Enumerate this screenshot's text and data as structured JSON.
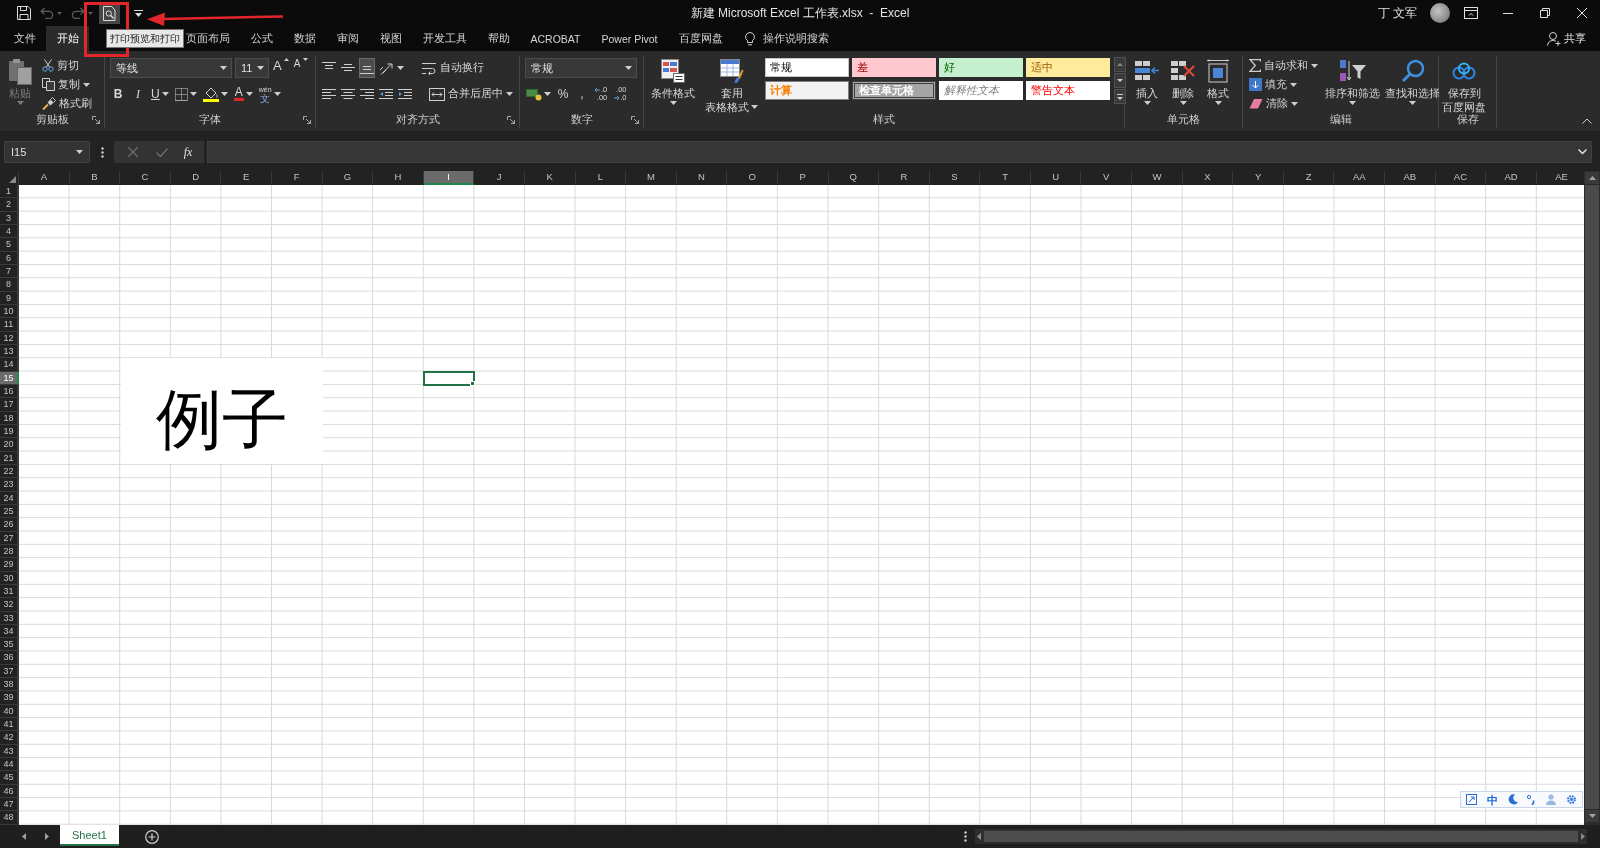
{
  "title_bar": {
    "quick_access": [
      {
        "kind": "save",
        "disabled": false,
        "highlighted": false
      },
      {
        "kind": "undo",
        "disabled": true,
        "highlighted": false
      },
      {
        "kind": "redo",
        "disabled": true,
        "highlighted": false
      },
      {
        "kind": "print_preview",
        "disabled": false,
        "highlighted": true
      },
      {
        "kind": "customize",
        "disabled": false,
        "highlighted": false
      }
    ],
    "title": "新建 Microsoft Excel 工作表.xlsx  -  Excel",
    "user": "丁 文军"
  },
  "tabs": [
    {
      "label": "文件",
      "selected": false
    },
    {
      "label": "开始",
      "selected": true
    },
    {
      "label": "页面布局",
      "selected": false
    },
    {
      "label": "公式",
      "selected": false
    },
    {
      "label": "数据",
      "selected": false
    },
    {
      "label": "审阅",
      "selected": false
    },
    {
      "label": "视图",
      "selected": false
    },
    {
      "label": "开发工具",
      "selected": false
    },
    {
      "label": "帮助",
      "selected": false
    },
    {
      "label": "ACROBAT",
      "selected": false
    },
    {
      "label": "Power Pivot",
      "selected": false
    },
    {
      "label": "百度网盘",
      "selected": false
    }
  ],
  "tell_me": "操作说明搜索",
  "share": "共享",
  "tooltip": "打印预览和打印",
  "ribbon": {
    "clipboard": {
      "label": "剪贴板",
      "paste": {
        "label": "粘贴",
        "disabled": true
      },
      "cut": "剪切",
      "copy": "复制",
      "format_painter": "格式刷"
    },
    "font": {
      "label": "字体",
      "font_name": "等线",
      "font_size": "11",
      "grow": "A",
      "shrink": "A",
      "bold": "B",
      "italic": "I",
      "underline": "U",
      "font_color": "A",
      "phonetic": {
        "ruby": "wén",
        "base": "文"
      }
    },
    "alignment": {
      "label": "对齐方式",
      "vertical": [
        {
          "kind": "top",
          "selected": false
        },
        {
          "kind": "middle",
          "selected": false
        },
        {
          "kind": "bottom",
          "selected": true
        }
      ],
      "wrap_text": "自动换行",
      "merge_center": "合并后居中"
    },
    "number": {
      "label": "数字",
      "format": "常规",
      "percent": "%",
      "comma": ",",
      "decimals": [
        {
          "kind": "increase",
          "top": ".0",
          "bottom": ".00"
        },
        {
          "kind": "decrease",
          "top": ".00",
          "bottom": ".0"
        }
      ]
    },
    "styles": {
      "label": "样式",
      "conditional_formatting": "条件格式",
      "format_as_table": [
        "套用",
        "表格格式"
      ],
      "gallery": [
        {
          "label": "常规",
          "kind": "normal"
        },
        {
          "label": "差",
          "kind": "bad"
        },
        {
          "label": "好",
          "kind": "good"
        },
        {
          "label": "适中",
          "kind": "neutral"
        },
        {
          "label": "计算",
          "kind": "calculation"
        },
        {
          "label": "检查单元格",
          "kind": "check"
        },
        {
          "label": "解释性文本",
          "kind": "explanatory"
        },
        {
          "label": "警告文本",
          "kind": "warning"
        }
      ]
    },
    "cells": {
      "label": "单元格",
      "buttons": [
        {
          "kind": "insert",
          "label": "插入"
        },
        {
          "kind": "delete",
          "label": "删除"
        },
        {
          "kind": "format",
          "label": "格式"
        }
      ]
    },
    "editing": {
      "label": "编辑",
      "autosum": "自动求和",
      "fill": "填充",
      "clear": "清除",
      "sort_filter": "排序和筛选",
      "find_select": "查找和选择"
    },
    "save": {
      "label": "保存",
      "button": [
        "保存到",
        "百度网盘"
      ]
    }
  },
  "formula_bar": {
    "name_box": "I15",
    "buttons": [
      {
        "kind": "cancel",
        "disabled": true
      },
      {
        "kind": "enter",
        "disabled": true
      }
    ],
    "function_symbol": "fx"
  },
  "sheet": {
    "columns": [
      {
        "label": "A",
        "selected": false
      },
      {
        "label": "B",
        "selected": false
      },
      {
        "label": "C",
        "selected": false
      },
      {
        "label": "D",
        "selected": false
      },
      {
        "label": "E",
        "selected": false
      },
      {
        "label": "F",
        "selected": false
      },
      {
        "label": "G",
        "selected": false
      },
      {
        "label": "H",
        "selected": false
      },
      {
        "label": "I",
        "selected": true
      },
      {
        "label": "J",
        "selected": false
      },
      {
        "label": "K",
        "selected": false
      },
      {
        "label": "L",
        "selected": false
      },
      {
        "label": "M",
        "selected": false
      },
      {
        "label": "N",
        "selected": false
      },
      {
        "label": "O",
        "selected": false
      },
      {
        "label": "P",
        "selected": false
      },
      {
        "label": "Q",
        "selected": false
      },
      {
        "label": "R",
        "selected": false
      },
      {
        "label": "S",
        "selected": false
      },
      {
        "label": "T",
        "selected": false
      },
      {
        "label": "U",
        "selected": false
      },
      {
        "label": "V",
        "selected": false
      },
      {
        "label": "W",
        "selected": false
      },
      {
        "label": "X",
        "selected": false
      },
      {
        "label": "Y",
        "selected": false
      },
      {
        "label": "Z",
        "selected": false
      },
      {
        "label": "AA",
        "selected": false
      },
      {
        "label": "AB",
        "selected": false
      },
      {
        "label": "AC",
        "selected": false
      },
      {
        "label": "AD",
        "selected": false
      },
      {
        "label": "AE",
        "selected": false
      }
    ],
    "rows": [
      {
        "label": "1",
        "selected": false
      },
      {
        "label": "2",
        "selected": false
      },
      {
        "label": "3",
        "selected": false
      },
      {
        "label": "4",
        "selected": false
      },
      {
        "label": "5",
        "selected": false
      },
      {
        "label": "6",
        "selected": false
      },
      {
        "label": "7",
        "selected": false
      },
      {
        "label": "8",
        "selected": false
      },
      {
        "label": "9",
        "selected": false
      },
      {
        "label": "10",
        "selected": false
      },
      {
        "label": "11",
        "selected": false
      },
      {
        "label": "12",
        "selected": false
      },
      {
        "label": "13",
        "selected": false
      },
      {
        "label": "14",
        "selected": false
      },
      {
        "label": "15",
        "selected": true
      },
      {
        "label": "16",
        "selected": false
      },
      {
        "label": "17",
        "selected": false
      },
      {
        "label": "18",
        "selected": false
      },
      {
        "label": "19",
        "selected": false
      },
      {
        "label": "20",
        "selected": false
      },
      {
        "label": "21",
        "selected": false
      },
      {
        "label": "22",
        "selected": false
      },
      {
        "label": "23",
        "selected": false
      },
      {
        "label": "24",
        "selected": false
      },
      {
        "label": "25",
        "selected": false
      },
      {
        "label": "26",
        "selected": false
      },
      {
        "label": "27",
        "selected": false
      },
      {
        "label": "28",
        "selected": false
      },
      {
        "label": "29",
        "selected": false
      },
      {
        "label": "30",
        "selected": false
      },
      {
        "label": "31",
        "selected": false
      },
      {
        "label": "32",
        "selected": false
      },
      {
        "label": "33",
        "selected": false
      },
      {
        "label": "34",
        "selected": false
      },
      {
        "label": "35",
        "selected": false
      },
      {
        "label": "36",
        "selected": false
      },
      {
        "label": "37",
        "selected": false
      },
      {
        "label": "38",
        "selected": false
      },
      {
        "label": "39",
        "selected": false
      },
      {
        "label": "40",
        "selected": false
      },
      {
        "label": "41",
        "selected": false
      },
      {
        "label": "42",
        "selected": false
      },
      {
        "label": "43",
        "selected": false
      },
      {
        "label": "44",
        "selected": false
      },
      {
        "label": "45",
        "selected": false
      },
      {
        "label": "46",
        "selected": false
      },
      {
        "label": "47",
        "selected": false
      },
      {
        "label": "48",
        "selected": false
      }
    ],
    "text_box": "例子"
  },
  "sheet_tabs": [
    {
      "label": "Sheet1",
      "selected": true
    }
  ],
  "ime_toolbar": {
    "mode": "中"
  }
}
